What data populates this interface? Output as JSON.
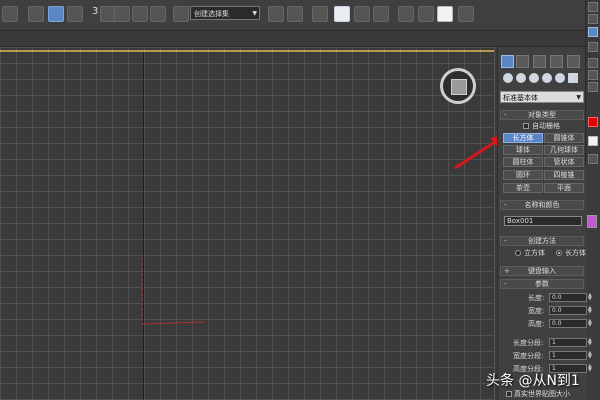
{
  "toolbar": {
    "dropdown_value": "创建选择集",
    "snap_number": "3"
  },
  "panel": {
    "category": "标准基本体",
    "object_type": {
      "header": "对象类型",
      "auto_grid": "自动栅格",
      "buttons": [
        {
          "label": "长方体",
          "active": true
        },
        {
          "label": "圆锥体"
        },
        {
          "label": "球体"
        },
        {
          "label": "几何球体"
        },
        {
          "label": "圆柱体"
        },
        {
          "label": "管状体"
        },
        {
          "label": "圆环"
        },
        {
          "label": "四棱锥"
        },
        {
          "label": "茶壶"
        },
        {
          "label": "平面"
        }
      ]
    },
    "name_color": {
      "header": "名称和颜色",
      "name_value": "Box001",
      "color": "#c05ad0"
    },
    "creation_method": {
      "header": "创建方法",
      "cube": "立方体",
      "box": "长方体",
      "selected": "box"
    },
    "keyboard_entry": {
      "header": "键盘输入"
    },
    "parameters": {
      "header": "参数",
      "length_label": "长度:",
      "length_value": "0.0",
      "width_label": "宽度:",
      "width_value": "0.0",
      "height_label": "高度:",
      "height_value": "0.0",
      "length_segs_label": "长度分段:",
      "length_segs_value": "1",
      "width_segs_label": "宽度分段:",
      "width_segs_value": "1",
      "height_segs_label": "高度分段:",
      "height_segs_value": "1",
      "real_world": "真实世界贴图大小"
    }
  },
  "colors": {
    "accent": "#5a86c6",
    "viewport_border": "#b59b4e",
    "annotation_red": "#d81818",
    "axis_red": "#b03030"
  },
  "watermark": "头条 @从N到1"
}
